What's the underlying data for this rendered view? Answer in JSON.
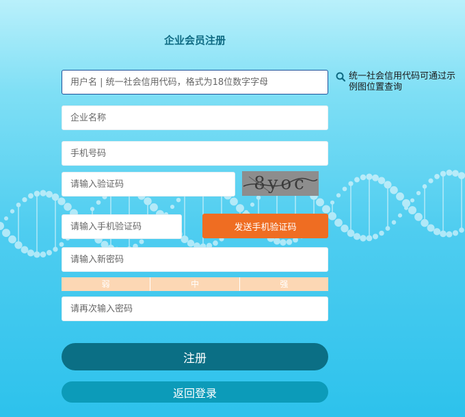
{
  "page": {
    "title": "企业会员注册"
  },
  "form": {
    "username_placeholder": "用户名 | 统一社会信用代码，格式为18位数字字母",
    "company_placeholder": "企业名称",
    "phone_placeholder": "手机号码",
    "captcha_placeholder": "请输入验证码",
    "captcha_text": "8yoc",
    "sms_code_placeholder": "请输入手机验证码",
    "send_sms_label": "发送手机验证码",
    "new_password_placeholder": "请输入新密码",
    "strength_labels": [
      "弱",
      "中",
      "强"
    ],
    "confirm_password_placeholder": "请再次输入密码",
    "register_label": "注册",
    "back_label": "返回登录"
  },
  "hint": {
    "text": "统一社会信用代码可通过示例图位置查询",
    "icon": "search-icon"
  },
  "colors": {
    "accent_orange": "#ef6d22",
    "register_bg": "#0b6f85",
    "back_bg": "#0c9bb9",
    "strength_bg": "#fcd7b4"
  }
}
